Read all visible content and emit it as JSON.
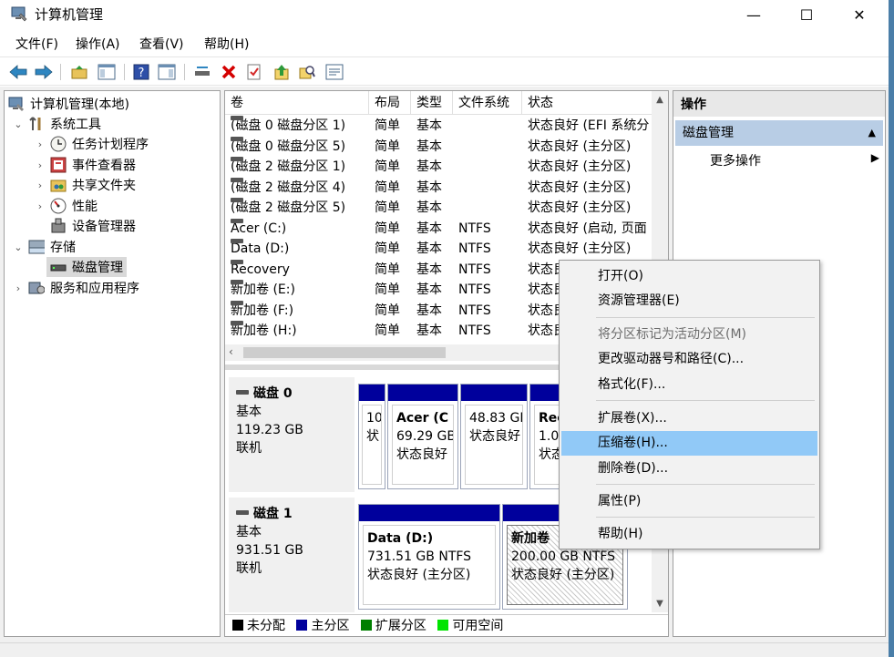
{
  "window": {
    "title": "计算机管理",
    "controls": {
      "minimize": "—",
      "maximize": "☐",
      "close": "✕"
    }
  },
  "menu": [
    "文件(F)",
    "操作(A)",
    "查看(V)",
    "帮助(H)"
  ],
  "tree": {
    "root": "计算机管理(本地)",
    "system_tools": "系统工具",
    "task_scheduler": "任务计划程序",
    "event_viewer": "事件查看器",
    "shared_folders": "共享文件夹",
    "performance": "性能",
    "device_manager": "设备管理器",
    "storage": "存储",
    "disk_management": "磁盘管理",
    "services_apps": "服务和应用程序"
  },
  "volume_list": {
    "columns": [
      "卷",
      "布局",
      "类型",
      "文件系统",
      "状态"
    ],
    "rows": [
      {
        "name": "(磁盘 0 磁盘分区 1)",
        "layout": "简单",
        "type": "基本",
        "fs": "",
        "status": "状态良好 (EFI 系统分"
      },
      {
        "name": "(磁盘 0 磁盘分区 5)",
        "layout": "简单",
        "type": "基本",
        "fs": "",
        "status": "状态良好 (主分区)"
      },
      {
        "name": "(磁盘 2 磁盘分区 1)",
        "layout": "简单",
        "type": "基本",
        "fs": "",
        "status": "状态良好 (主分区)"
      },
      {
        "name": "(磁盘 2 磁盘分区 4)",
        "layout": "简单",
        "type": "基本",
        "fs": "",
        "status": "状态良好 (主分区)"
      },
      {
        "name": "(磁盘 2 磁盘分区 5)",
        "layout": "简单",
        "type": "基本",
        "fs": "",
        "status": "状态良好 (主分区)"
      },
      {
        "name": "Acer (C:)",
        "layout": "简单",
        "type": "基本",
        "fs": "NTFS",
        "status": "状态良好 (启动, 页面"
      },
      {
        "name": "Data (D:)",
        "layout": "简单",
        "type": "基本",
        "fs": "NTFS",
        "status": "状态良好 (主分区)"
      },
      {
        "name": "Recovery",
        "layout": "简单",
        "type": "基本",
        "fs": "NTFS",
        "status": "状态良"
      },
      {
        "name": "新加卷 (E:)",
        "layout": "简单",
        "type": "基本",
        "fs": "NTFS",
        "status": "状态良"
      },
      {
        "name": "新加卷 (F:)",
        "layout": "简单",
        "type": "基本",
        "fs": "NTFS",
        "status": "状态良"
      },
      {
        "name": "新加卷 (H:)",
        "layout": "简单",
        "type": "基本",
        "fs": "NTFS",
        "status": "状态良"
      }
    ]
  },
  "disks": [
    {
      "name": "磁盘 0",
      "kind": "基本",
      "size": "119.23 GB",
      "state": "联机",
      "partitions": [
        {
          "line1": "",
          "line2": "10",
          "line3": "状"
        },
        {
          "line1": "Acer (C",
          "line2": "69.29 GB",
          "line3": "状态良好"
        },
        {
          "line1": "",
          "line2": "48.83 GB",
          "line3": "状态良好"
        },
        {
          "line1": "Rec",
          "line2": "1.00",
          "line3": "状态"
        }
      ]
    },
    {
      "name": "磁盘 1",
      "kind": "基本",
      "size": "931.51 GB",
      "state": "联机",
      "partitions": [
        {
          "line1": "Data  (D:)",
          "line2": "731.51 GB NTFS",
          "line3": "状态良好 (主分区)"
        },
        {
          "line1": "新加卷",
          "line2": "200.00 GB NTFS",
          "line3": "状态良好 (主分区)"
        }
      ]
    }
  ],
  "legend": [
    {
      "label": "未分配",
      "color": "#000000"
    },
    {
      "label": "主分区",
      "color": "#00009c"
    },
    {
      "label": "扩展分区",
      "color": "#007f00"
    },
    {
      "label": "可用空间",
      "color": "#00e400"
    }
  ],
  "actions": {
    "header": "操作",
    "section": "磁盘管理",
    "more": "更多操作"
  },
  "context_menu": [
    {
      "label": "打开(O)",
      "enabled": true
    },
    {
      "label": "资源管理器(E)",
      "enabled": true
    },
    {
      "label": "将分区标记为活动分区(M)",
      "enabled": false
    },
    {
      "label": "更改驱动器号和路径(C)...",
      "enabled": true
    },
    {
      "label": "格式化(F)...",
      "enabled": true
    },
    {
      "label": "扩展卷(X)...",
      "enabled": true
    },
    {
      "label": "压缩卷(H)...",
      "enabled": true,
      "highlighted": true
    },
    {
      "label": "删除卷(D)...",
      "enabled": true
    },
    {
      "label": "属性(P)",
      "enabled": true
    },
    {
      "label": "帮助(H)",
      "enabled": true
    }
  ],
  "colors": {
    "accent": "#00009c",
    "selection": "#b8cde5",
    "menu_highlight": "#91c9f7"
  }
}
